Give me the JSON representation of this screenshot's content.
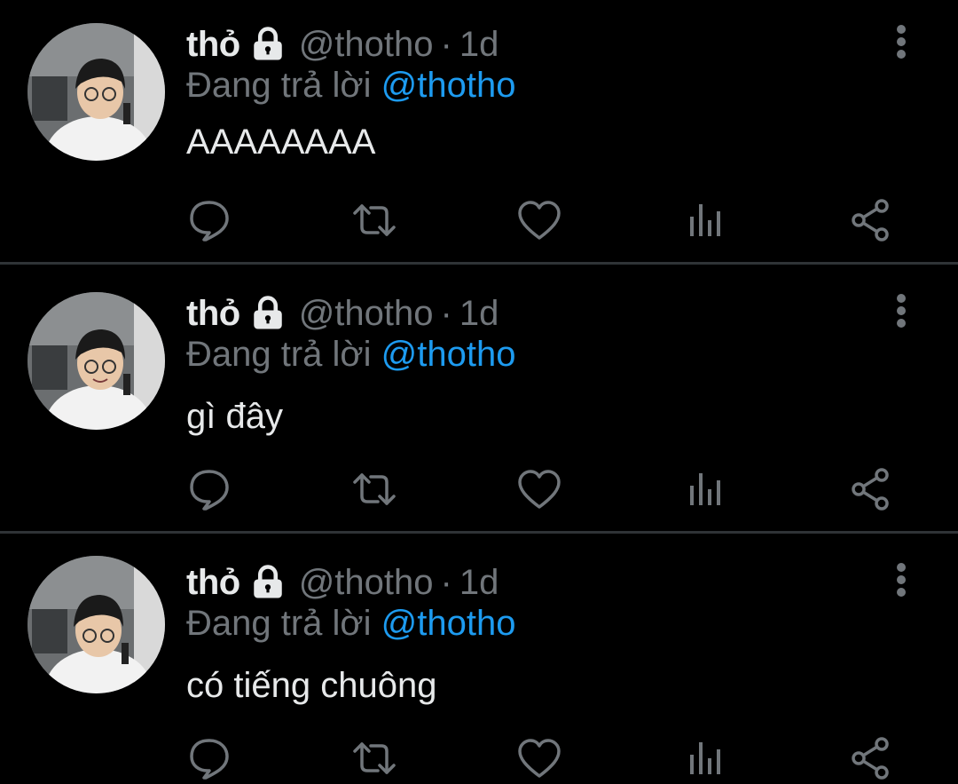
{
  "colors": {
    "background": "#000000",
    "primary_text": "#e7e9ea",
    "secondary_text": "#71767b",
    "mention": "#1d9bf0",
    "divider": "#2f3336"
  },
  "tweets": [
    {
      "display_name": "thỏ",
      "handle": "@thotho",
      "separator": "·",
      "time": "1d",
      "replying_prefix": "Đang trả lời",
      "replying_to": "@thotho",
      "text": "AAAAAAAA"
    },
    {
      "display_name": "thỏ",
      "handle": "@thotho",
      "separator": "·",
      "time": "1d",
      "replying_prefix": "Đang trả lời",
      "replying_to": "@thotho",
      "text": "gì đây"
    },
    {
      "display_name": "thỏ",
      "handle": "@thotho",
      "separator": "·",
      "time": "1d",
      "replying_prefix": "Đang trả lời",
      "replying_to": "@thotho",
      "text": "có tiếng chuông"
    }
  ],
  "icons": {
    "protected": "lock-icon",
    "more": "more-vertical-icon",
    "reply": "reply-icon",
    "retweet": "retweet-icon",
    "like": "heart-icon",
    "analytics": "analytics-icon",
    "share": "share-icon"
  }
}
